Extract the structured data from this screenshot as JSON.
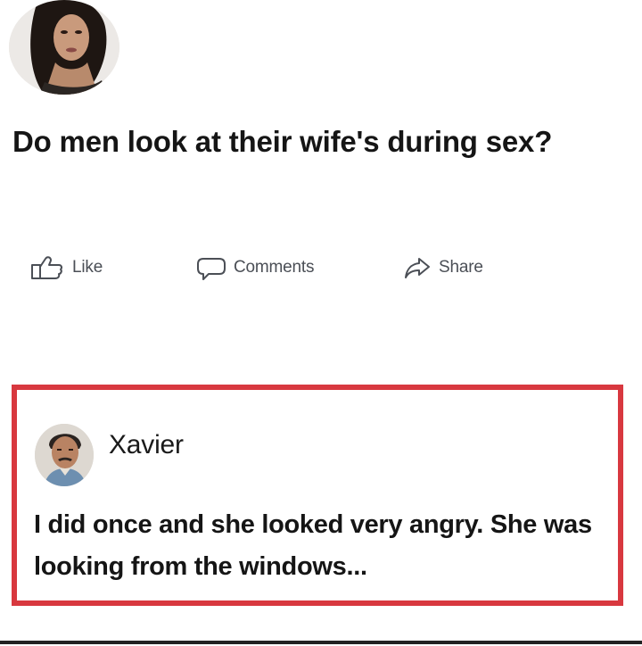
{
  "post": {
    "avatar_icon": "profile-photo-woman",
    "text": "Do men look at their wife's during sex?"
  },
  "actions": {
    "like": {
      "label": "Like",
      "icon": "thumbs-up-icon"
    },
    "comments": {
      "label": "Comments",
      "icon": "speech-bubble-icon"
    },
    "share": {
      "label": "Share",
      "icon": "share-arrow-icon"
    }
  },
  "comment": {
    "author": "Xavier",
    "avatar_icon": "profile-photo-man",
    "text": "I did once and she looked very angry. She was looking from the windows..."
  },
  "colors": {
    "highlight_border": "#d8383f",
    "action_text": "#4b4f56"
  }
}
